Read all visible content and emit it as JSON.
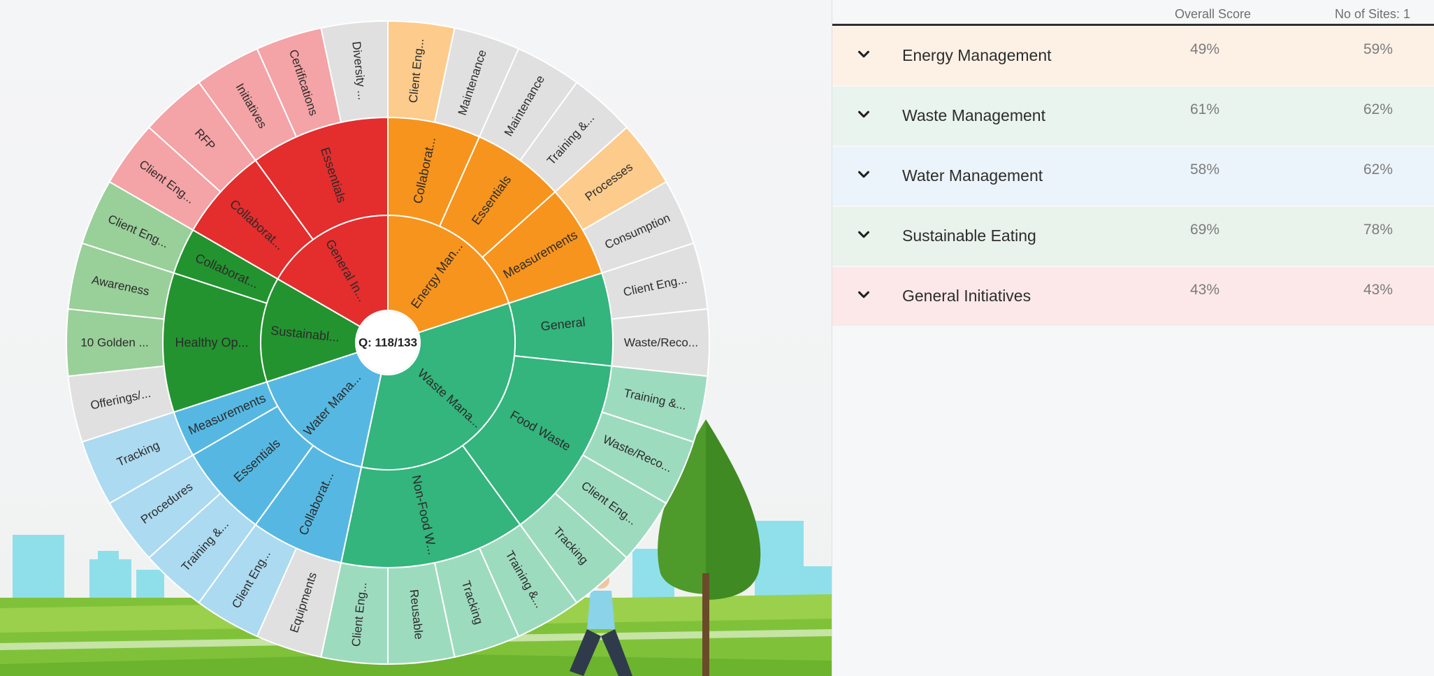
{
  "sunburst": {
    "center_label": "Q: 118/133",
    "segments": [
      {
        "name": "Energy Management",
        "label": "Energy Man...",
        "color": "#f7941d",
        "children": [
          {
            "label": "Collaborat...",
            "leaves": [
              {
                "label": "Client Eng...",
                "color": "#fdcb8b"
              },
              {
                "label": "Maintenance",
                "color": "#e0e0e0"
              }
            ]
          },
          {
            "label": "Essentials",
            "leaves": [
              {
                "label": "Maintenance",
                "color": "#e0e0e0"
              },
              {
                "label": "Training &...",
                "color": "#e0e0e0"
              }
            ]
          },
          {
            "label": "Measurements",
            "leaves": [
              {
                "label": "Processes",
                "color": "#fdcb8b"
              },
              {
                "label": "Consumption",
                "color": "#e0e0e0"
              }
            ]
          }
        ]
      },
      {
        "name": "Waste Management",
        "label": "Waste Mana...",
        "color": "#33b57d",
        "children": [
          {
            "label": "General",
            "leaves": [
              {
                "label": "Client Eng...",
                "color": "#e0e0e0"
              },
              {
                "label": "Waste/Reco...",
                "color": "#e0e0e0"
              }
            ]
          },
          {
            "label": "Food Waste",
            "leaves": [
              {
                "label": "Training &...",
                "color": "#9ddbbf"
              },
              {
                "label": "Waste/Reco...",
                "color": "#9ddbbf"
              },
              {
                "label": "Client Eng...",
                "color": "#9ddbbf"
              },
              {
                "label": "Tracking",
                "color": "#9ddbbf"
              }
            ]
          },
          {
            "label": "Non-Food W...",
            "leaves": [
              {
                "label": "Training &...",
                "color": "#9ddbbf"
              },
              {
                "label": "Tracking",
                "color": "#9ddbbf"
              },
              {
                "label": "Reusable",
                "color": "#9ddbbf"
              },
              {
                "label": "Client Eng...",
                "color": "#9ddbbf"
              }
            ]
          }
        ]
      },
      {
        "name": "Water Management",
        "label": "Water Mana...",
        "color": "#56b8e2",
        "children": [
          {
            "label": "Collaborat...",
            "leaves": [
              {
                "label": "Equipments",
                "color": "#e0e0e0"
              },
              {
                "label": "Client Eng...",
                "color": "#acdaf0"
              }
            ]
          },
          {
            "label": "Essentials",
            "leaves": [
              {
                "label": "Training &...",
                "color": "#acdaf0"
              },
              {
                "label": "Procedures",
                "color": "#acdaf0"
              }
            ]
          },
          {
            "label": "Measurements",
            "leaves": [
              {
                "label": "Tracking",
                "color": "#acdaf0"
              }
            ]
          }
        ]
      },
      {
        "name": "Sustainable Eating",
        "label": "Sustainabl...",
        "color": "#23932f",
        "children": [
          {
            "label": "Healthy Op...",
            "leaves": [
              {
                "label": "Offerings/...",
                "color": "#e0e0e0"
              },
              {
                "label": "10 Golden ...",
                "color": "#99cf99"
              },
              {
                "label": "Awareness",
                "color": "#99cf99"
              }
            ]
          },
          {
            "label": "Collaborat...",
            "leaves": [
              {
                "label": "Client Eng...",
                "color": "#99cf99"
              }
            ]
          }
        ]
      },
      {
        "name": "General Initiatives",
        "label": "General In...",
        "color": "#e42d2d",
        "children": [
          {
            "label": "Collaborat...",
            "leaves": [
              {
                "label": "Client Eng...",
                "color": "#f4a3a6"
              },
              {
                "label": "RFP",
                "color": "#f4a3a6"
              }
            ]
          },
          {
            "label": "Essentials",
            "leaves": [
              {
                "label": "Initiatives",
                "color": "#f4a3a6"
              },
              {
                "label": "Certifications",
                "color": "#f4a3a6"
              },
              {
                "label": "Diversity ...",
                "color": "#e0e0e0"
              }
            ]
          }
        ]
      }
    ]
  },
  "table": {
    "header_score": "Overall Score",
    "header_sites": "No of Sites: 1",
    "rows": [
      {
        "name": "Energy Management",
        "score": "49%",
        "sites": "59%",
        "bg": "#fdf1e6"
      },
      {
        "name": "Waste Management",
        "score": "61%",
        "sites": "62%",
        "bg": "#eaf4ef"
      },
      {
        "name": "Water Management",
        "score": "58%",
        "sites": "62%",
        "bg": "#ecf4fb"
      },
      {
        "name": "Sustainable Eating",
        "score": "69%",
        "sites": "78%",
        "bg": "#eaf2ec"
      },
      {
        "name": "General Initiatives",
        "score": "43%",
        "sites": "43%",
        "bg": "#fce8e8"
      }
    ]
  },
  "icons": {
    "row_toggle": "chevron-down-icon"
  }
}
